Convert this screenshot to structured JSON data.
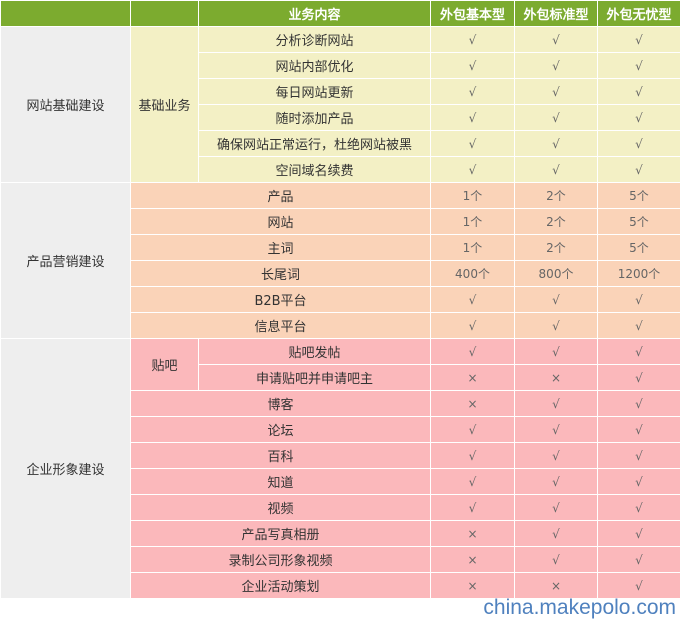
{
  "header": {
    "col_blank_1": "",
    "col_blank_2": "",
    "col_content": "业务内容",
    "plans": [
      "外包基本型",
      "外包标准型",
      "外包无忧型"
    ]
  },
  "groups": [
    {
      "category": "网站基础建设",
      "subcategory": "基础业务",
      "rows": [
        {
          "item": "分析诊断网站",
          "values": [
            "√",
            "√",
            "√"
          ]
        },
        {
          "item": "网站内部优化",
          "values": [
            "√",
            "√",
            "√"
          ]
        },
        {
          "item": "每日网站更新",
          "values": [
            "√",
            "√",
            "√"
          ]
        },
        {
          "item": "随时添加产品",
          "values": [
            "√",
            "√",
            "√"
          ]
        },
        {
          "item": "确保网站正常运行，杜绝网站被黑",
          "values": [
            "√",
            "√",
            "√"
          ]
        },
        {
          "item": "空间域名续费",
          "values": [
            "√",
            "√",
            "√"
          ]
        }
      ]
    },
    {
      "category": "产品营销建设",
      "rows": [
        {
          "item": "产品",
          "values": [
            "1个",
            "2个",
            "5个"
          ]
        },
        {
          "item": "网站",
          "values": [
            "1个",
            "2个",
            "5个"
          ]
        },
        {
          "item": "主词",
          "values": [
            "1个",
            "2个",
            "5个"
          ]
        },
        {
          "item": "长尾词",
          "values": [
            "400个",
            "800个",
            "1200个"
          ]
        },
        {
          "item": "B2B平台",
          "values": [
            "√",
            "√",
            "√"
          ]
        },
        {
          "item": "信息平台",
          "values": [
            "√",
            "√",
            "√"
          ]
        }
      ]
    },
    {
      "category": "企业形象建设",
      "subcategory": "贴吧",
      "rows": [
        {
          "item": "贴吧发帖",
          "values": [
            "√",
            "√",
            "√"
          ]
        },
        {
          "item": "申请贴吧并申请吧主",
          "values": [
            "×",
            "×",
            "√"
          ]
        },
        {
          "item": "博客",
          "values": [
            "×",
            "√",
            "√"
          ]
        },
        {
          "item": "论坛",
          "values": [
            "√",
            "√",
            "√"
          ]
        },
        {
          "item": "百科",
          "values": [
            "√",
            "√",
            "√"
          ]
        },
        {
          "item": "知道",
          "values": [
            "√",
            "√",
            "√"
          ]
        },
        {
          "item": "视频",
          "values": [
            "√",
            "√",
            "√"
          ]
        },
        {
          "item": "产品写真相册",
          "values": [
            "×",
            "√",
            "√"
          ]
        },
        {
          "item": "录制公司形象视频",
          "values": [
            "×",
            "√",
            "√"
          ]
        },
        {
          "item": "企业活动策划",
          "values": [
            "×",
            "×",
            "√"
          ]
        }
      ]
    }
  ],
  "watermark": "china.makepolo.com"
}
